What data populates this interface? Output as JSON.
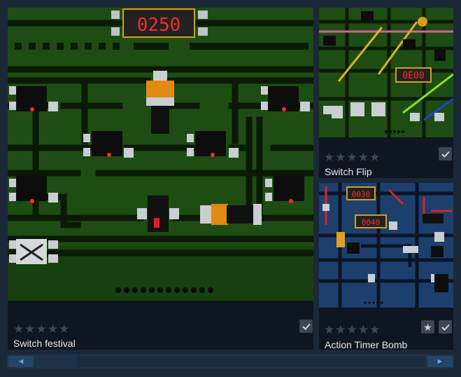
{
  "cards": [
    {
      "title": "Switch festival",
      "rating_stars": 5,
      "timer_display": "0250"
    },
    {
      "title": "Switch Flip",
      "rating_stars": 5,
      "timer_display": "0E00"
    },
    {
      "title": "Action Timer Bomb",
      "rating_stars": 5,
      "timer_display": [
        "0030",
        "0040"
      ]
    }
  ],
  "scrollbar": {
    "left_arrow": "◄",
    "right_arrow": "►"
  },
  "colors": {
    "page_bg": "#1b2838",
    "card_bg": "#0e1621",
    "pcb_green": "#1d4d12",
    "pcb_blue": "#1c3f6e",
    "led_red": "#ff2a2a",
    "scroll_accent": "#5aa9e6"
  }
}
